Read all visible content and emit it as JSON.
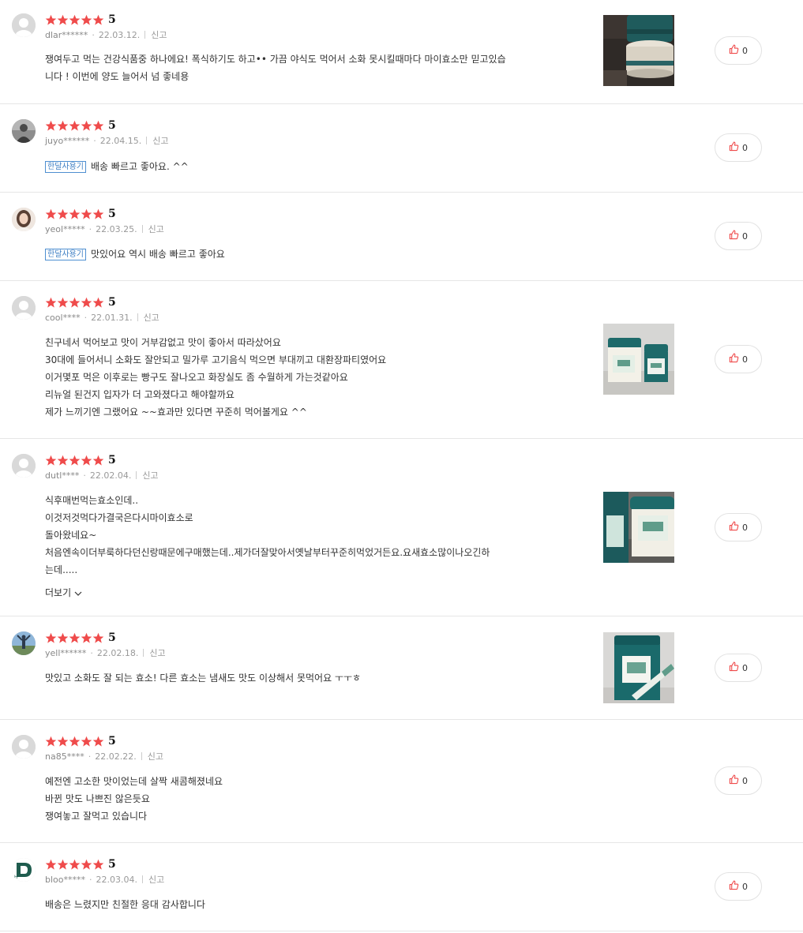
{
  "colors": {
    "star": "#ef4b4b",
    "badge": "#3f7fc4",
    "like_icon": "#ef4b4b",
    "divider": "#e6e6e6"
  },
  "reviews": [
    {
      "rating": "5",
      "user": "dlar******",
      "date": "22.03.12.",
      "report": "신고",
      "badge": "",
      "lines": [
        "쟁여두고 먹는 건강식품중 하나에요! 폭식하기도 하고•• 가끔 야식도 먹어서 소화 못시킬때마다 마이효소만 믿고있습",
        "니다 ! 이번에 양도 늘어서 넘 좋네용"
      ],
      "likes": "0",
      "avatar": "default",
      "photo": "photo-jars-dark"
    },
    {
      "rating": "5",
      "user": "juyo******",
      "date": "22.04.15.",
      "report": "신고",
      "badge": "한달사용기",
      "lines": [
        "배송 빠르고 좋아요. ^^"
      ],
      "likes": "0",
      "avatar": "profile-person",
      "photo": ""
    },
    {
      "rating": "5",
      "user": "yeol*****",
      "date": "22.03.25.",
      "report": "신고",
      "badge": "한달사용기",
      "lines": [
        "맛있어요 역시 배송 빠르고 좋아요"
      ],
      "likes": "0",
      "avatar": "profile-woman",
      "photo": ""
    },
    {
      "rating": "5",
      "user": "cool****",
      "date": "22.01.31.",
      "report": "신고",
      "badge": "",
      "lines": [
        "친구네서 먹어보고 맛이 거부감없고 맛이 좋아서 따라샀어요",
        "30대에 들어서니 소화도 잘안되고 밀가루 고기음식 먹으면 부대끼고 대환장파티였어요",
        "이거몇포 먹은 이후로는 빵구도 잘나오고 화장실도 좀 수월하게 가는것같아요",
        "리뉴얼 된건지 입자가 더 고와졌다고 해야할까요",
        "제가 느끼기엔 그랬어요 ~~효과만 있다면 꾸준히 먹어볼게요 ^^"
      ],
      "likes": "0",
      "avatar": "default",
      "photo": "photo-two-jars"
    },
    {
      "rating": "5",
      "user": "dutl****",
      "date": "22.02.04.",
      "report": "신고",
      "badge": "",
      "lines": [
        "식후매번먹는효소인데..",
        "이것저것먹다가결국은다시마이효소로",
        "돌아왔네요~",
        "처음엔속이더부룩하다던신랑때문에구매했는데..제가더잘맞아서옛날부터꾸준히먹었거든요.요새효소많이나오긴하",
        "는데....."
      ],
      "more": "더보기",
      "likes": "0",
      "avatar": "default",
      "photo": "photo-jars-closeup"
    },
    {
      "rating": "5",
      "user": "yell******",
      "date": "22.02.18.",
      "report": "신고",
      "badge": "",
      "lines": [
        "맛있고 소화도 잘 되는 효소! 다른 효소는 냄새도 맛도 이상해서 못먹어요 ㅜㅜㅎ"
      ],
      "likes": "0",
      "avatar": "profile-outdoor",
      "photo": "photo-jar-stick"
    },
    {
      "rating": "5",
      "user": "na85****",
      "date": "22.02.22.",
      "report": "신고",
      "badge": "",
      "lines": [
        "예전엔 고소한 맛이었는데 살짝 새콤해졌네요",
        "바뀐 맛도 나쁘진 않은듯요",
        "쟁여놓고 잘먹고 있습니다"
      ],
      "likes": "0",
      "avatar": "default",
      "photo": ""
    },
    {
      "rating": "5",
      "user": "bloo*****",
      "date": "22.03.04.",
      "report": "신고",
      "badge": "",
      "lines": [
        "배송은 느렸지만 친절한 응대 감사합니다"
      ],
      "likes": "0",
      "avatar": "profile-logo-d",
      "photo": ""
    }
  ]
}
